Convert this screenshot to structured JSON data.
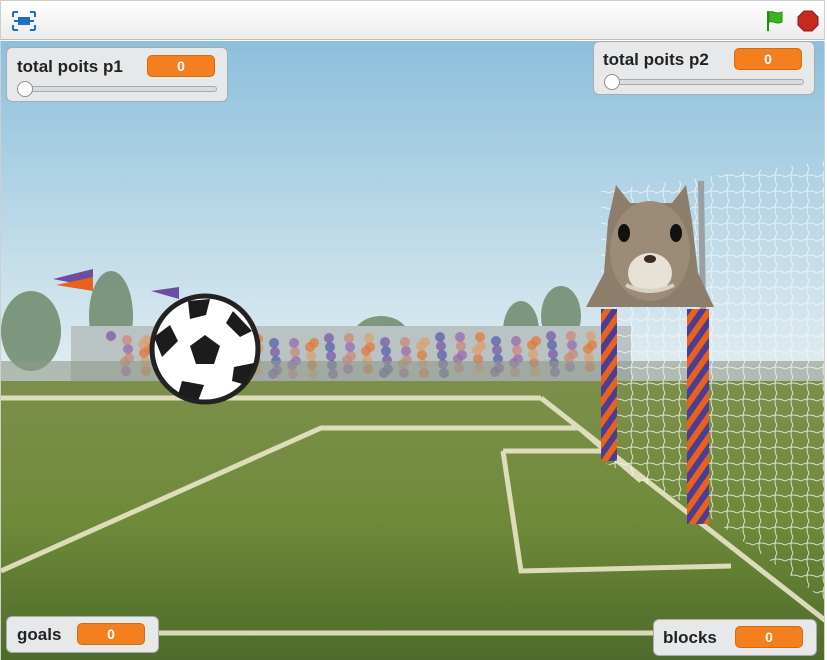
{
  "toolbar": {
    "fullscreen_icon": "fullscreen-icon",
    "green_flag_icon": "green-flag-icon",
    "stop_icon": "stop-icon",
    "flag_color": "#3cb422",
    "stop_color": "#c9281f"
  },
  "monitors": {
    "p1": {
      "label": "total poits p1",
      "value": "0",
      "slider_fraction": 0
    },
    "p2": {
      "label": "total poits p2",
      "value": "0",
      "slider_fraction": 0
    },
    "goals": {
      "label": "goals",
      "value": "0"
    },
    "blocks": {
      "label": "blocks",
      "value": "0"
    }
  },
  "stage": {
    "backdrop": "soccer-field-backdrop",
    "sprites": [
      "soccer-ball",
      "squirrel-goalkeeper"
    ]
  }
}
